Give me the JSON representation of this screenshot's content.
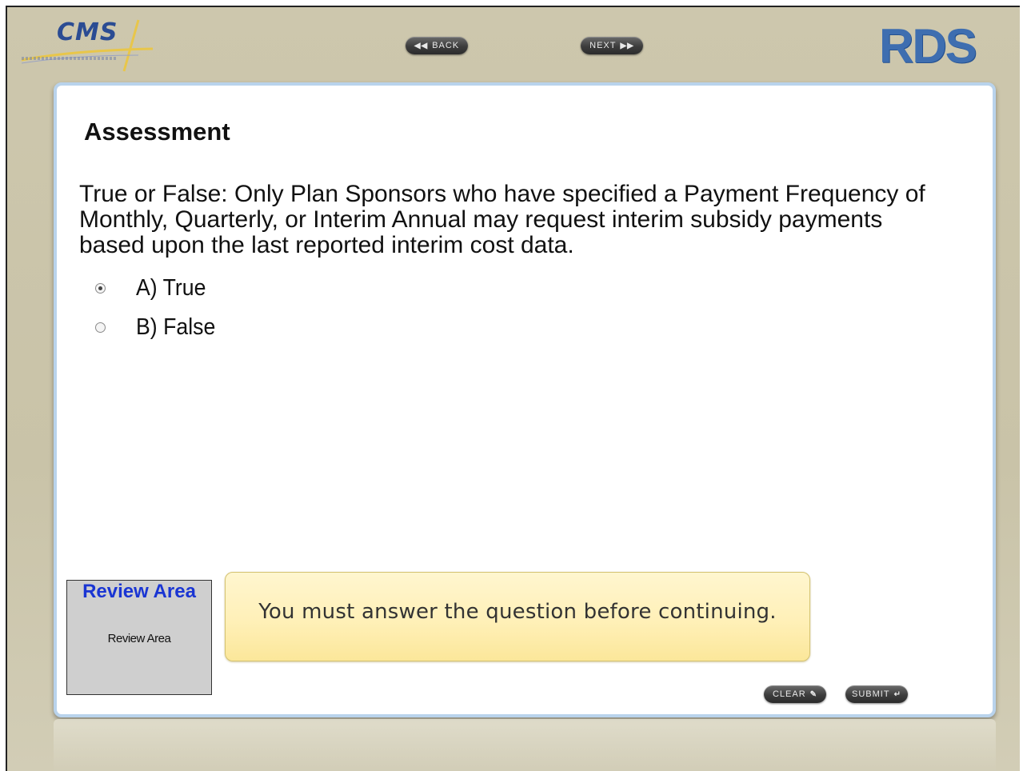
{
  "header": {
    "cms_logo_text": "CMS",
    "rds_logo_text": "RDS",
    "back_label": "BACK",
    "next_label": "NEXT",
    "back_glyph": "◀◀",
    "next_glyph": "▶▶"
  },
  "assessment": {
    "title": "Assessment",
    "question": "True or False: Only Plan Sponsors who have specified a Payment Frequency of Monthly, Quarterly, or Interim Annual may request interim subsidy payments based upon the last reported interim cost data.",
    "options": [
      {
        "label": "A) True",
        "selected": true
      },
      {
        "label": "B) False",
        "selected": false
      }
    ]
  },
  "review": {
    "heading": "Review Area",
    "text": "Review Area"
  },
  "message": {
    "text": "You must answer the question before continuing."
  },
  "actions": {
    "clear_label": "CLEAR",
    "submit_label": "SUBMIT",
    "clear_glyph": "✎",
    "submit_glyph": "↵"
  },
  "colors": {
    "frame_bg": "#cdc7ad",
    "panel_border": "#b9d3ec",
    "review_heading": "#1a35d3",
    "message_bg": "#fff0b8"
  }
}
